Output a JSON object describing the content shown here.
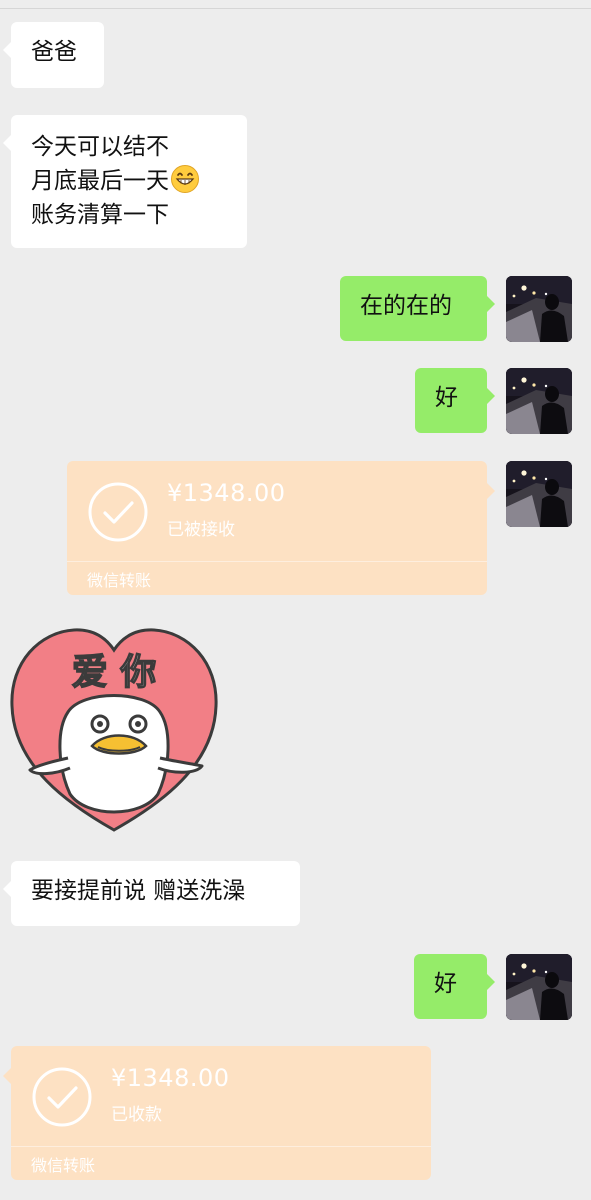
{
  "messages": {
    "m1": "爸爸",
    "m2": {
      "line1": "今天可以结不",
      "line2": "月底最后一天",
      "line3": "账务清算一下"
    },
    "m3": "在的在的",
    "m4": "好",
    "m5": {
      "amount": "¥1348.00",
      "status": "已被接收",
      "footer": "微信转账"
    },
    "m6": {
      "sticker_text": "爱 你"
    },
    "m7": "要接提前说 赠送洗澡",
    "m8": "好",
    "m9": {
      "amount": "¥1348.00",
      "status": "已收款",
      "footer": "微信转账"
    }
  },
  "icons": {
    "emoji": "grinning-face-icon",
    "transfer": "check-circle-icon"
  },
  "colors": {
    "background": "#ededed",
    "incoming_bubble": "#ffffff",
    "outgoing_bubble": "#95ec69",
    "transfer_card": "#fde1c3",
    "sticker_heart": "#f27f86"
  }
}
